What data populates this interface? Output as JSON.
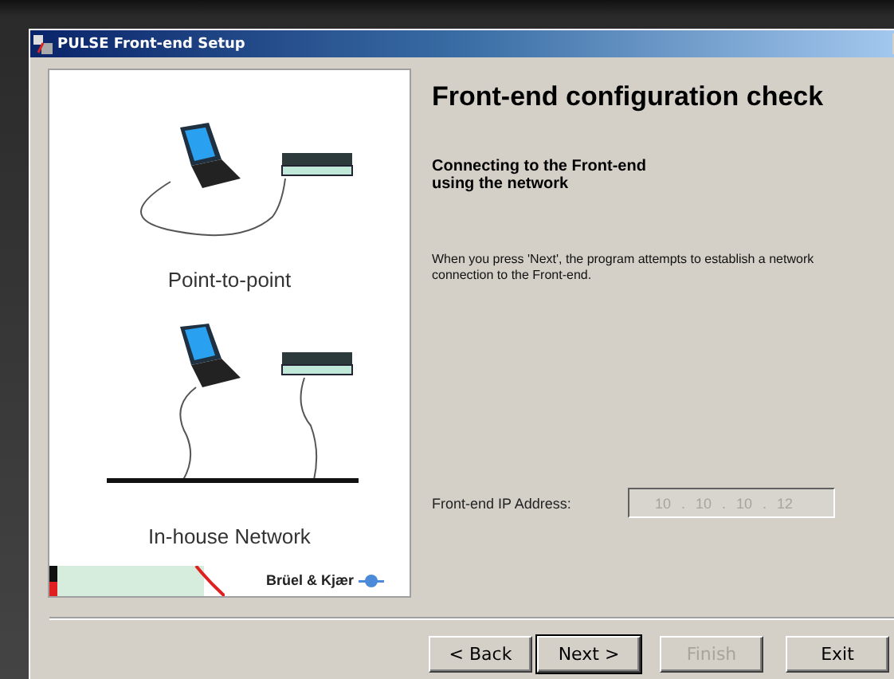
{
  "window": {
    "title": "PULSE Front-end Setup"
  },
  "illustration": {
    "sections": [
      {
        "kind": "point-to-point",
        "caption": "Point-to-point"
      },
      {
        "kind": "network",
        "caption": "In-house Network"
      }
    ],
    "logo": "Brüel & Kjær"
  },
  "heading": "Front-end configuration check",
  "subheading": "Connecting to the Front-end using the network",
  "description": "When you press 'Next', the program attempts to establish a network connection to the Front-end.",
  "ip_field": {
    "label": "Front-end IP Address:",
    "octets": [
      "10",
      "10",
      "10",
      "12"
    ],
    "separator": ".",
    "disabled": true
  },
  "buttons": [
    {
      "label": "< Back",
      "default": false,
      "disabled": false
    },
    {
      "label": "Next >",
      "default": true,
      "disabled": false
    },
    {
      "label": "Finish",
      "default": false,
      "disabled": true
    },
    {
      "label": "Exit",
      "default": false,
      "disabled": false
    }
  ]
}
